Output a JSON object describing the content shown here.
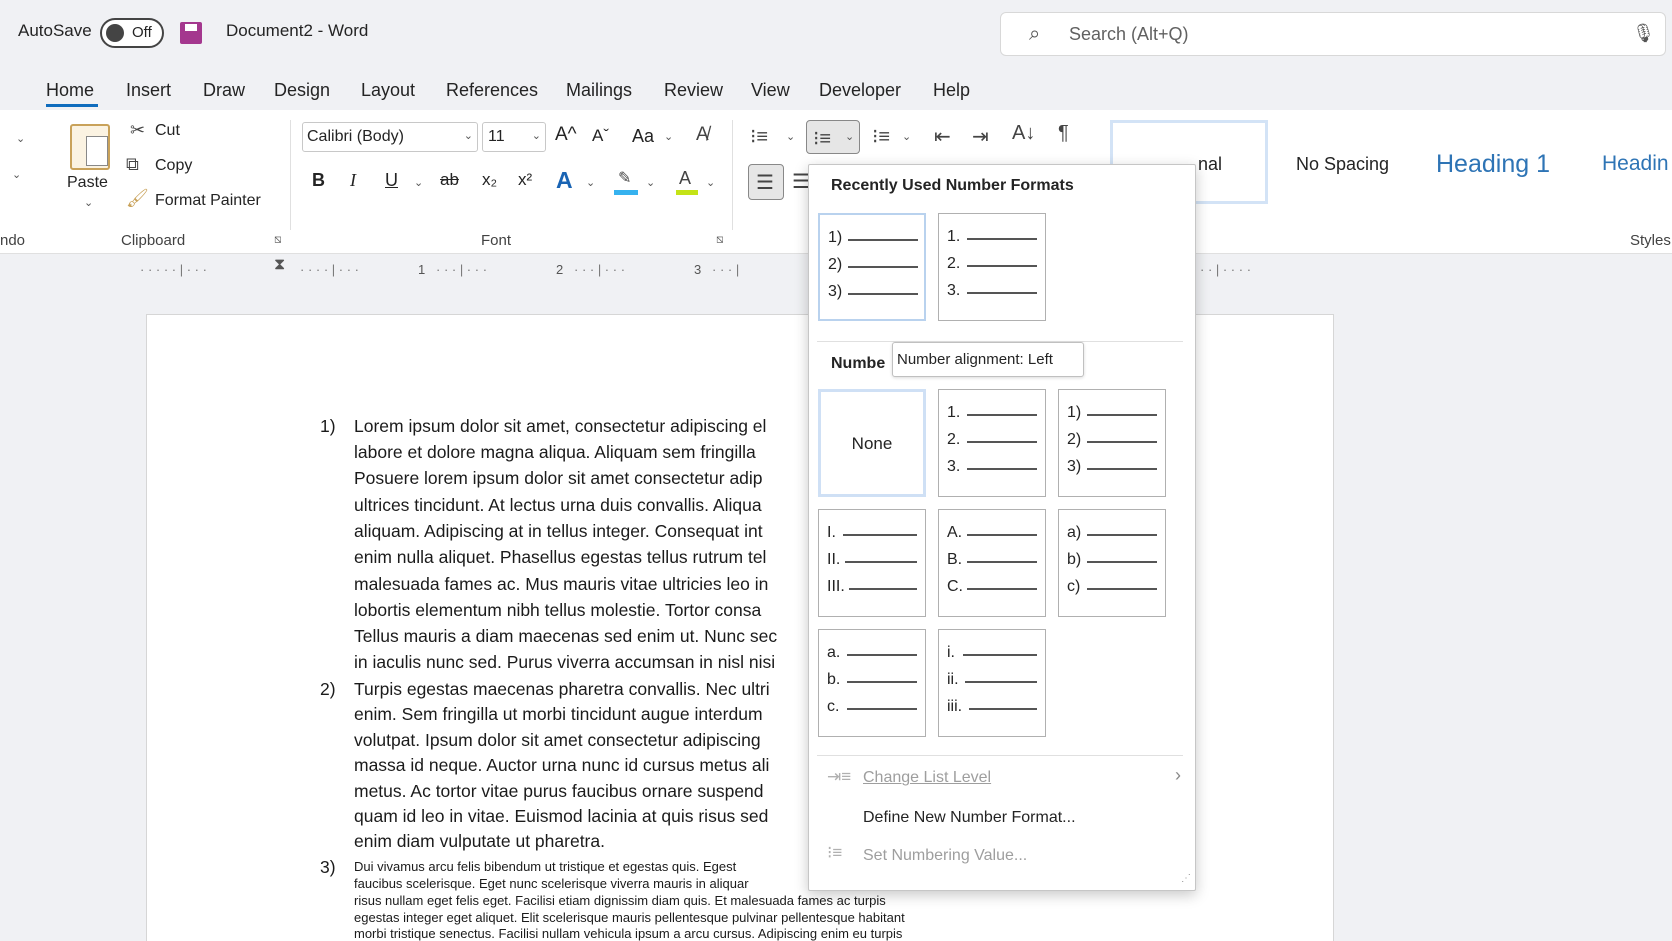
{
  "titlebar": {
    "autosave": "AutoSave",
    "toggle": "Off",
    "doc": "Document2  -  Word",
    "search_placeholder": "Search (Alt+Q)"
  },
  "tabs": [
    "Home",
    "Insert",
    "Draw",
    "Design",
    "Layout",
    "References",
    "Mailings",
    "Review",
    "View",
    "Developer",
    "Help"
  ],
  "clipboard": {
    "paste": "Paste",
    "cut": "Cut",
    "copy": "Copy",
    "format_painter": "Format Painter",
    "label": "Clipboard",
    "left_label": "ndo"
  },
  "font": {
    "name": "Calibri (Body)",
    "size": "11",
    "label": "Font",
    "grow": "A^",
    "shrink": "Aˇ",
    "case": "Aa",
    "bold": "B",
    "italic": "I",
    "underline": "U",
    "strike": "ab",
    "sub": "x₂",
    "sup": "x²",
    "effects": "A",
    "font_color": "A"
  },
  "styles": {
    "normal": "nal",
    "no_spacing": "No Spacing",
    "heading1": "Heading 1",
    "heading2": "Headin",
    "label": "Styles"
  },
  "ruler": {
    "marks": [
      "1",
      "2",
      "3"
    ]
  },
  "document": {
    "item1_num": "1)",
    "item1": [
      "Lorem ipsum dolor sit amet, consectetur adipiscing el",
      "labore et dolore magna aliqua. Aliquam sem fringilla",
      "Posuere lorem ipsum dolor sit amet consectetur adip",
      "ultrices tincidunt. At lectus urna duis convallis. Aliqua",
      "aliquam. Adipiscing at in tellus integer. Consequat int",
      "enim nulla aliquet. Phasellus egestas tellus rutrum tel",
      "malesuada fames ac. Mus mauris vitae ultricies leo in",
      "lobortis elementum nibh tellus molestie. Tortor consa",
      "Tellus mauris a diam maecenas sed enim ut. Nunc sec",
      "in iaculis nunc sed. Purus viverra accumsan in nisl nisi"
    ],
    "item2_num": "2)",
    "item2": [
      "Turpis egestas maecenas pharetra convallis. Nec ultri",
      "enim. Sem fringilla ut morbi tincidunt augue interdum",
      "volutpat. Ipsum dolor sit amet consectetur adipiscing",
      "massa id neque. Auctor urna nunc id cursus metus ali",
      "metus. Ac tortor vitae purus faucibus ornare suspend",
      "quam id leo in vitae. Euismod lacinia at quis risus sed",
      "enim diam vulputate ut pharetra."
    ],
    "item3_num": "3)",
    "item3": [
      "Dui vivamus arcu felis bibendum ut tristique et egestas quis. Egest",
      "faucibus scelerisque. Eget nunc scelerisque viverra mauris in aliquar",
      "risus nullam eget felis eget. Facilisi etiam dignissim diam quis. Et malesuada fames ac turpis",
      "egestas integer eget aliquet. Elit scelerisque mauris pellentesque pulvinar pellentesque habitant",
      "morbi tristique senectus. Facilisi nullam vehicula ipsum a arcu cursus. Adipiscing enim eu turpis"
    ]
  },
  "panel": {
    "recent_header": "Recently Used Number Formats",
    "library_header": "Numbe",
    "tooltip": "Number alignment: Left",
    "recent": [
      [
        "1)",
        "2)",
        "3)"
      ],
      [
        "1.",
        "2.",
        "3."
      ]
    ],
    "none": "None",
    "library": [
      [
        "1.",
        "2.",
        "3."
      ],
      [
        "1)",
        "2)",
        "3)"
      ],
      [
        "I.",
        "II.",
        "III."
      ],
      [
        "A.",
        "B.",
        "C."
      ],
      [
        "a)",
        "b)",
        "c)"
      ],
      [
        "a.",
        "b.",
        "c."
      ],
      [
        "i.",
        "ii.",
        "iii."
      ]
    ],
    "change_level": "Change List Level",
    "define_new": "Define New Number Format...",
    "set_value": "Set Numbering Value..."
  }
}
